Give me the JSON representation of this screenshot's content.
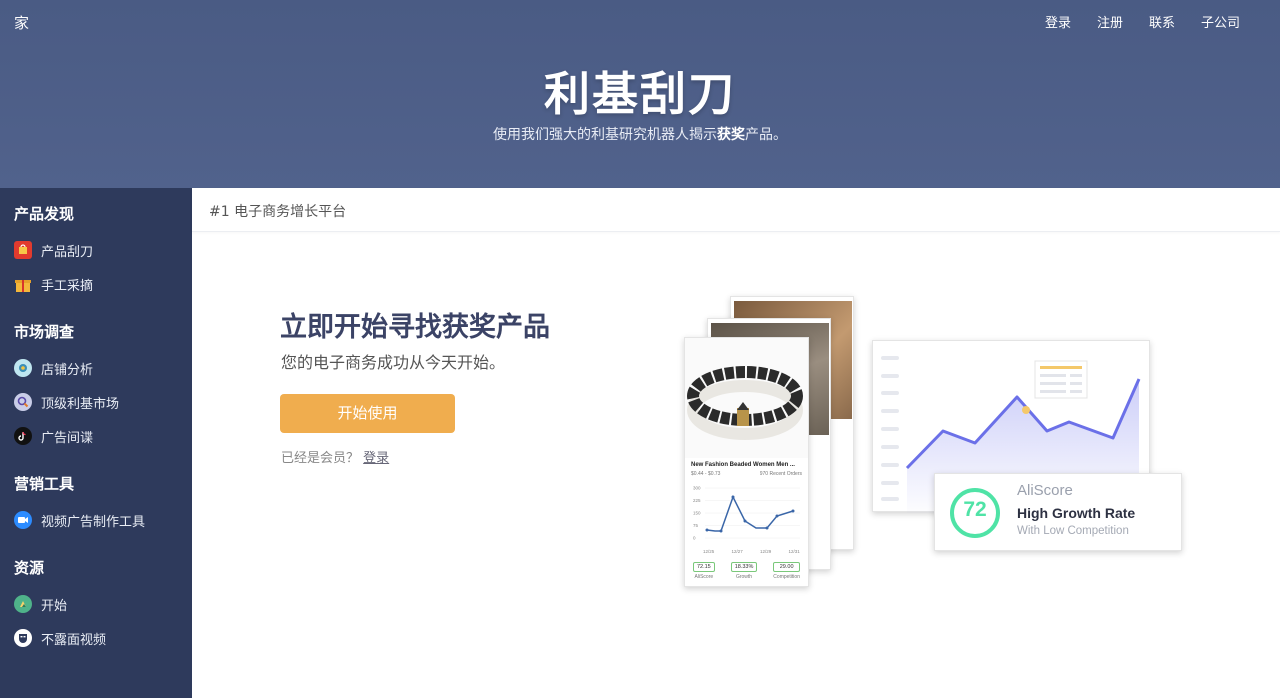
{
  "header": {
    "home": "家",
    "nav": [
      "登录",
      "注册",
      "联系",
      "子公司"
    ],
    "title": "利基刮刀",
    "subtitle_before": "使用我们强大的利基研究机器人揭示",
    "subtitle_bold": "获奖",
    "subtitle_after": "产品。"
  },
  "sidebar": {
    "sections": [
      {
        "heading": "产品发现",
        "items": [
          {
            "label": "产品刮刀",
            "icon": "red-bag-icon"
          },
          {
            "label": "手工采摘",
            "icon": "gift-icon"
          }
        ]
      },
      {
        "heading": "市场调查",
        "items": [
          {
            "label": "店铺分析",
            "icon": "eye-icon"
          },
          {
            "label": "顶级利基市场",
            "icon": "magnifier-icon"
          },
          {
            "label": "广告间谍",
            "icon": "tiktok-icon"
          }
        ]
      },
      {
        "heading": "营销工具",
        "items": [
          {
            "label": "视频广告制作工具",
            "icon": "video-camera-icon"
          }
        ]
      },
      {
        "heading": "资源",
        "items": [
          {
            "label": "开始",
            "icon": "play-icon"
          },
          {
            "label": "不露面视频",
            "icon": "mask-icon"
          }
        ]
      }
    ]
  },
  "content": {
    "breadcrumb": "#1 电子商务增长平台",
    "cta_title": "立即开始寻找获奖产品",
    "cta_subtitle": "您的电子商务成功从今天开始。",
    "cta_button": "开始使用",
    "member_text": "已经是会员？",
    "member_link": "登录"
  },
  "illustration": {
    "product_name": "New Fashion Beaded Women Men ...",
    "price": "$0.44 - $0.73",
    "orders": "970 Recent Orders",
    "y_ticks": [
      "300",
      "225",
      "150",
      "75",
      "0"
    ],
    "x_ticks": [
      "12/25",
      "12/27",
      "12/29",
      "12/31"
    ],
    "stats": [
      {
        "value": "72.15",
        "label": "AliScore"
      },
      {
        "value": "18.33%",
        "label": "Growth"
      },
      {
        "value": "29.00",
        "label": "Competition"
      }
    ],
    "score": "72",
    "score_label": "AliScore",
    "score_title": "High Growth Rate",
    "score_sub": "With Low Competition",
    "colors": {
      "accent": "#f0ad4e",
      "line": "#6b70e8",
      "score": "#4fe3a6",
      "header": "#4c5d86",
      "sidebar": "#2e3a5c"
    }
  }
}
